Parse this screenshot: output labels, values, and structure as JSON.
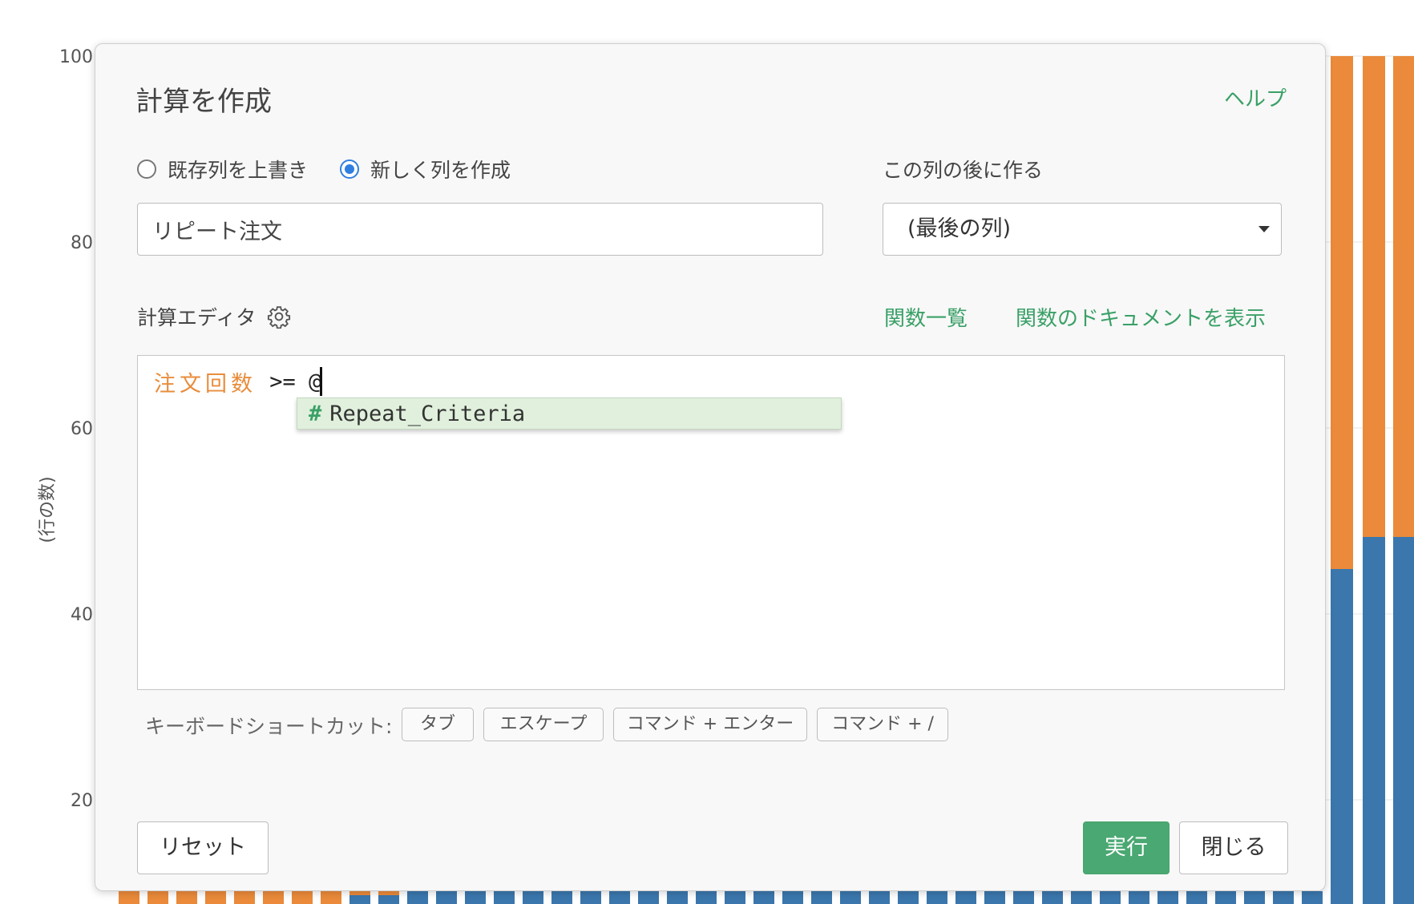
{
  "background_chart": {
    "y_axis_label": "(行の数)",
    "y_ticks": [
      "100",
      "80",
      "60",
      "40",
      "20"
    ],
    "colors": {
      "orange": "#ea8a3a",
      "blue": "#3b77ad"
    }
  },
  "dialog": {
    "title": "計算を作成",
    "help_link": "ヘルプ",
    "mode_options": [
      {
        "label": "既存列を上書き",
        "checked": false
      },
      {
        "label": "新しく列を作成",
        "checked": true
      }
    ],
    "new_column_name": "リピート注文",
    "insert_after_label": "この列の後に作る",
    "insert_after_value": "(最後の列)",
    "editor_label": "計算エディタ",
    "function_list_link": "関数一覧",
    "function_doc_link": "関数のドキュメントを表示",
    "code": {
      "column_token": "注文回数",
      "operator_text": " >= @"
    },
    "autocomplete": {
      "symbol": "#",
      "suggestion": "Repeat_Criteria"
    },
    "shortcuts_label": "キーボードショートカット:",
    "shortcuts": [
      "タブ",
      "エスケープ",
      "コマンド + エンター",
      "コマンド + /"
    ],
    "buttons": {
      "reset": "リセット",
      "run": "実行",
      "close": "閉じる"
    },
    "accent_color": "#3aa067"
  }
}
